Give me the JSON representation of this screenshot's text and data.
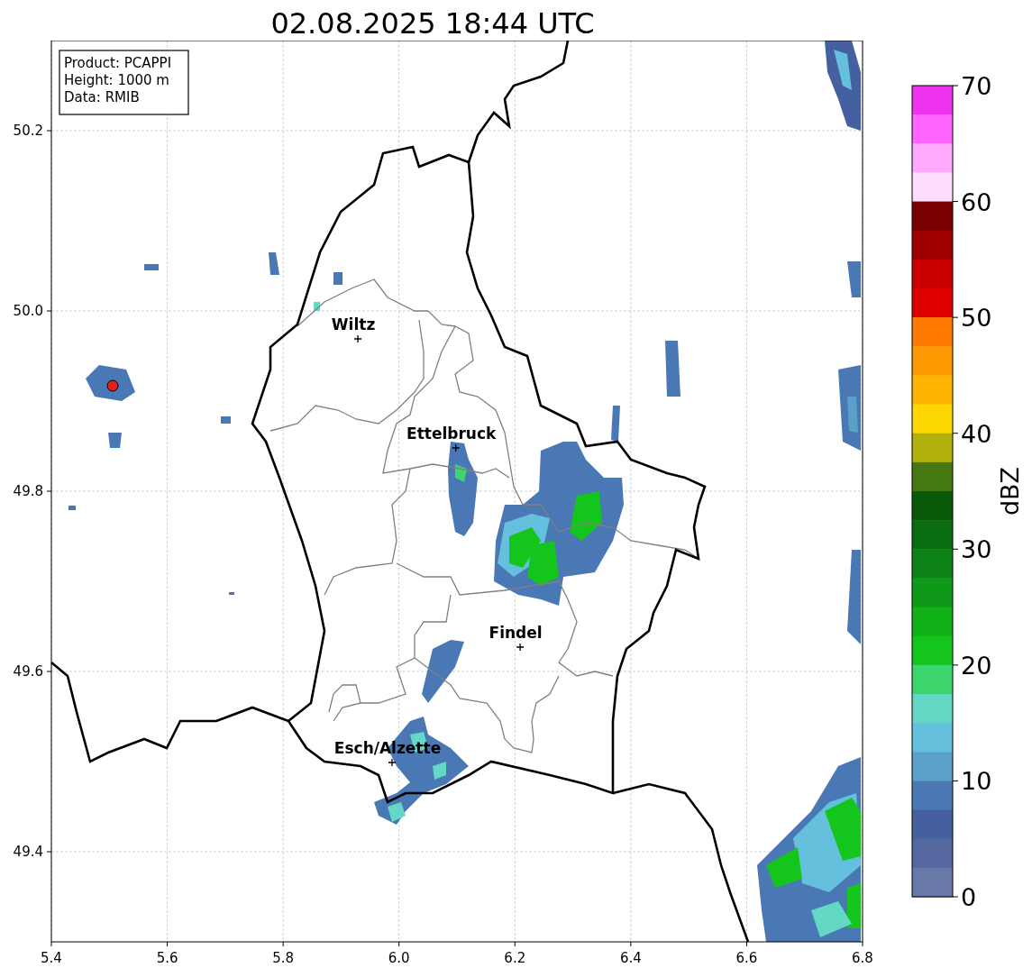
{
  "title": "02.08.2025 18:44 UTC",
  "info_box": [
    "Product: PCAPPI",
    "Height: 1000 m",
    "Data: RMIB"
  ],
  "map": {
    "xticks": [
      "5.4",
      "5.6",
      "5.8",
      "6.0",
      "6.2",
      "6.4",
      "6.6",
      "6.8"
    ],
    "yticks": [
      "50.2",
      "50.0",
      "49.8",
      "49.6",
      "49.4"
    ],
    "cities": [
      {
        "name": "Wiltz"
      },
      {
        "name": "Ettelbruck"
      },
      {
        "name": "Findel"
      },
      {
        "name": "Esch/Alzette"
      }
    ]
  },
  "colorbar": {
    "label": "dBZ",
    "ticks": [
      "70",
      "60",
      "50",
      "40",
      "30",
      "20",
      "10",
      "0"
    ],
    "bins": [
      {
        "color": "#ee33ee"
      },
      {
        "color": "#ff66ff"
      },
      {
        "color": "#ffaaff"
      },
      {
        "color": "#ffddff"
      },
      {
        "color": "#780000"
      },
      {
        "color": "#a00000"
      },
      {
        "color": "#c80000"
      },
      {
        "color": "#e00000"
      },
      {
        "color": "#ff7a00"
      },
      {
        "color": "#ff9900"
      },
      {
        "color": "#ffb400"
      },
      {
        "color": "#ffd700"
      },
      {
        "color": "#afb00c"
      },
      {
        "color": "#457810"
      },
      {
        "color": "#085a0a"
      },
      {
        "color": "#0a6e10"
      },
      {
        "color": "#0d8218"
      },
      {
        "color": "#0e9a18"
      },
      {
        "color": "#10b218"
      },
      {
        "color": "#14c61c"
      },
      {
        "color": "#3dd66e"
      },
      {
        "color": "#64d8c4"
      },
      {
        "color": "#64c0dc"
      },
      {
        "color": "#5aa0c8"
      },
      {
        "color": "#4a78b4"
      },
      {
        "color": "#4460a0"
      },
      {
        "color": "#5568a0"
      },
      {
        "color": "#6878a8"
      }
    ]
  }
}
